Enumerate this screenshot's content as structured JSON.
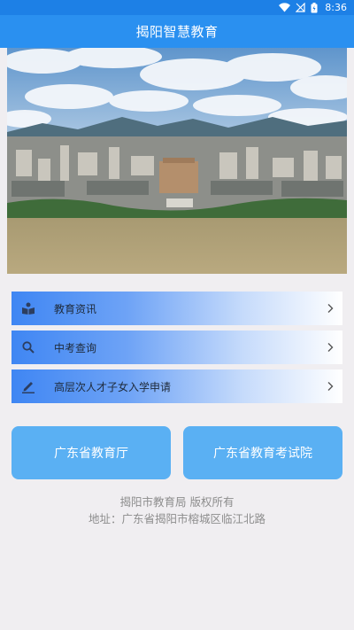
{
  "status_bar": {
    "time": "8:36"
  },
  "app_bar": {
    "title": "揭阳智慧教育"
  },
  "menu": [
    {
      "label": "教育资讯",
      "icon": "reading-book-icon"
    },
    {
      "label": "中考查询",
      "icon": "search-icon"
    },
    {
      "label": "高层次人才子女入学申请",
      "icon": "pen-edit-icon"
    }
  ],
  "buttons": {
    "left": "广东省教育厅",
    "right": "广东省教育考试院"
  },
  "footer": {
    "copyright": "揭阳市教育局 版权所有",
    "address": "地址：广东省揭阳市榕城区临江北路"
  },
  "colors": {
    "app_bar": "#2a90f0",
    "status_bar": "#1d80e6",
    "button": "#5ab0f3",
    "background": "#f0eef1"
  }
}
